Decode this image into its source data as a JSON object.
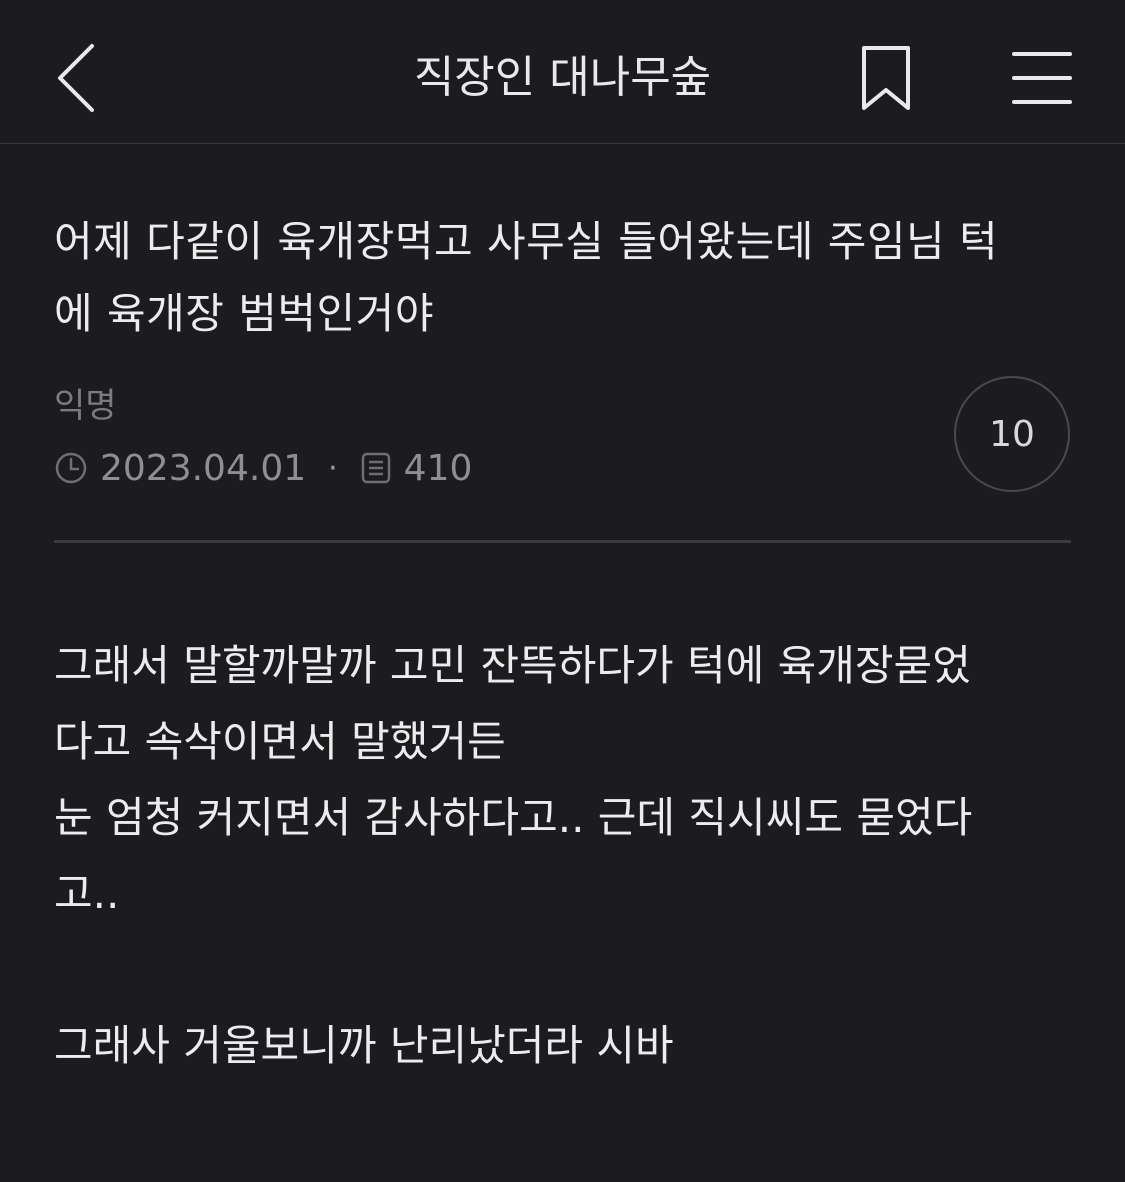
{
  "header": {
    "title": "직장인 대나무숲",
    "back_icon": "chevron-left-icon",
    "bookmark_icon": "bookmark-icon",
    "menu_icon": "hamburger-menu-icon"
  },
  "post": {
    "title_line1": "어제 다같이 육개장먹고 사무실 들어왔는데 주임님 턱",
    "title_line2": "에 육개장 범벅인거야",
    "author": "익명",
    "date": "2023.04.01",
    "separator": "·",
    "views": "410",
    "comment_count": "10",
    "body": {
      "line1": "그래서 말할까말까 고민 잔뜩하다가 턱에 육개장묻었",
      "line2": "다고 속삭이면서 말했거든",
      "line3": "눈 엄청 커지면서 감사하다고.. 근데 직시씨도 묻었다",
      "line4": "고..",
      "line5": "그래사 거울보니까 난리났더라 시바"
    }
  },
  "colors": {
    "background": "#1c1c1e",
    "text": "#ececee",
    "muted": "#8e8e93",
    "divider": "#3a3a3c"
  }
}
